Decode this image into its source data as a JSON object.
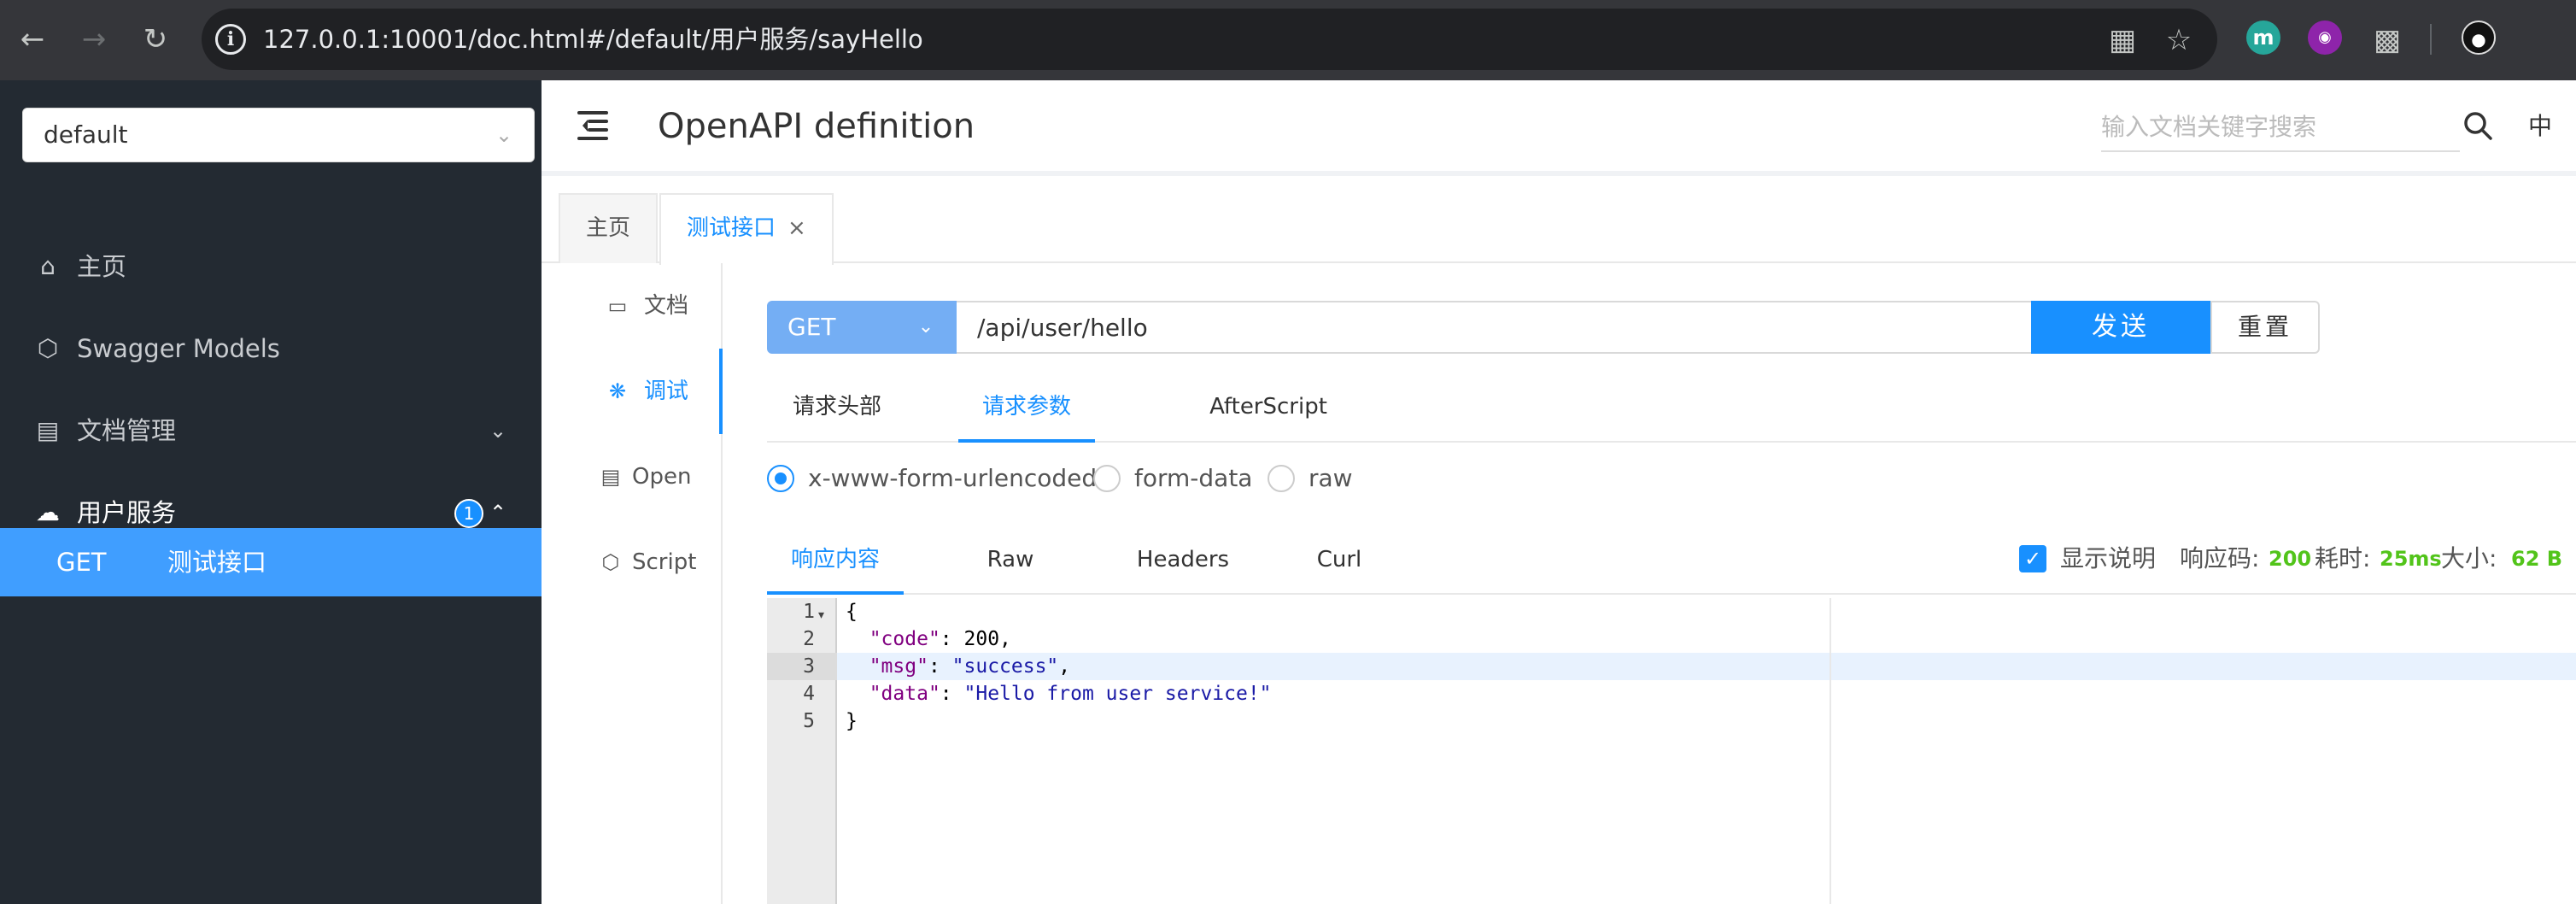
{
  "browser": {
    "url": "127.0.0.1:10001/doc.html#/default/用户服务/sayHello",
    "extensions": [
      "m"
    ]
  },
  "sidebar": {
    "group_select": "default",
    "items": [
      {
        "label": "主页",
        "icon": "home-icon"
      },
      {
        "label": "Swagger Models",
        "icon": "codepen-icon"
      },
      {
        "label": "文档管理",
        "icon": "file-search-icon"
      },
      {
        "label": "用户服务",
        "icon": "cloud-icon",
        "badge": "1"
      }
    ],
    "sub_item": {
      "method": "GET",
      "name": "测试接口"
    }
  },
  "header": {
    "title": "OpenAPI definition",
    "search_placeholder": "输入文档关键字搜索",
    "lang": "中"
  },
  "tabs": [
    {
      "label": "主页"
    },
    {
      "label": "测试接口",
      "close": "×"
    }
  ],
  "inner_nav": [
    {
      "label": "文档",
      "icon": "file-icon"
    },
    {
      "label": "调试",
      "icon": "bug-icon"
    },
    {
      "label": "Open",
      "icon": "file-text-icon"
    },
    {
      "label": "Script",
      "icon": "codepen-icon"
    }
  ],
  "request": {
    "method": "GET",
    "url": "/api/user/hello",
    "send_label": "发送",
    "reset_label": "重置"
  },
  "request_tabs": [
    "请求头部",
    "请求参数",
    "AfterScript"
  ],
  "content_types": [
    "x-www-form-urlencoded",
    "form-data",
    "raw"
  ],
  "response_tabs": [
    "响应内容",
    "Raw",
    "Headers",
    "Curl"
  ],
  "response_meta": {
    "show_desc_label": "显示说明",
    "code_label": "响应码:",
    "code": "200",
    "time_label": "耗时:",
    "time": "25ms",
    "size_label": "大小:",
    "size": "62 B"
  },
  "code_lines": [
    {
      "n": "1",
      "text": "{"
    },
    {
      "n": "2",
      "key": "\"code\"",
      "sep": ": ",
      "val": "200",
      "end": ","
    },
    {
      "n": "3",
      "key": "\"msg\"",
      "sep": ": ",
      "val": "\"success\"",
      "end": ","
    },
    {
      "n": "4",
      "key": "\"data\"",
      "sep": ": ",
      "val": "\"Hello from user service!\"",
      "end": ""
    },
    {
      "n": "5",
      "text": "}"
    }
  ],
  "colors": {
    "accent": "#1890ff",
    "sidebar_bg": "#232a32",
    "status_green": "#52c41a"
  }
}
